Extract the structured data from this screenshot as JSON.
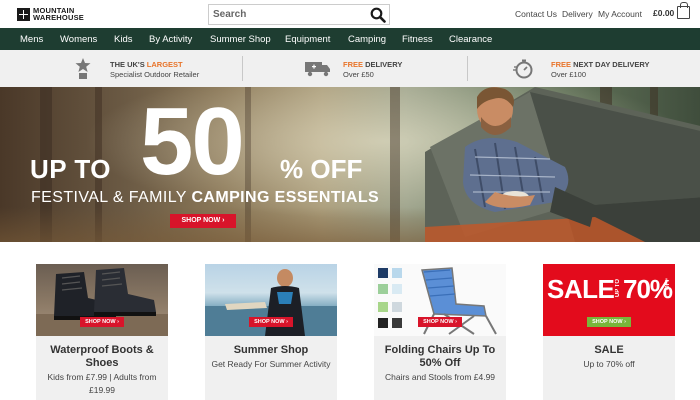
{
  "header": {
    "logo_line1": "MOUNTAIN",
    "logo_line2": "WAREHOUSE",
    "search_placeholder": "Search",
    "links": [
      "Contact Us",
      "Delivery",
      "My Account"
    ],
    "basket_total": "£0.00"
  },
  "nav": {
    "items": [
      "Mens",
      "Womens",
      "Kids",
      "By Activity",
      "Summer Shop",
      "Equipment",
      "Camping",
      "Fitness",
      "Clearance"
    ]
  },
  "usp": [
    {
      "title_prefix": "THE UK'S ",
      "title_highlight": "LARGEST",
      "title_suffix": "",
      "sub": "Specialist Outdoor Retailer",
      "icon": "award-icon"
    },
    {
      "title_prefix": "",
      "title_highlight": "FREE",
      "title_suffix": " DELIVERY",
      "sub": "Over £50",
      "icon": "truck-icon"
    },
    {
      "title_prefix": "",
      "title_highlight": "FREE",
      "title_suffix": " NEXT DAY DELIVERY",
      "sub": "Over £100",
      "icon": "stopwatch-icon"
    }
  ],
  "hero": {
    "up_to": "UP TO",
    "big_number": "50",
    "percent_off": "% OFF",
    "line2_regular": "FESTIVAL & FAMILY ",
    "line2_bold": "CAMPING ESSENTIALS",
    "button": "SHOP NOW ›"
  },
  "cards": [
    {
      "title": "Waterproof Boots & Shoes",
      "sub": "Kids from £7.99 | Adults from £19.99",
      "button": "SHOP NOW ›"
    },
    {
      "title": "Summer Shop",
      "sub": "Get Ready For Summer Activity",
      "button": "SHOP NOW ›"
    },
    {
      "title": "Folding Chairs Up To 50% Off",
      "sub": "Chairs and Stools from £4.99",
      "button": "SHOP NOW ›"
    },
    {
      "title": "SALE",
      "sub": "Up to 70% off",
      "button": "SHOP NOW ›",
      "banner_word": "SALE",
      "banner_upto": "UP TO",
      "banner_pct": "70%",
      "banner_off": "OFF"
    }
  ],
  "colors": {
    "nav_bg": "#1e3d31",
    "accent_orange": "#e8742a",
    "cta_red": "#d8142a",
    "usp_bg": "#f0f0f0"
  }
}
